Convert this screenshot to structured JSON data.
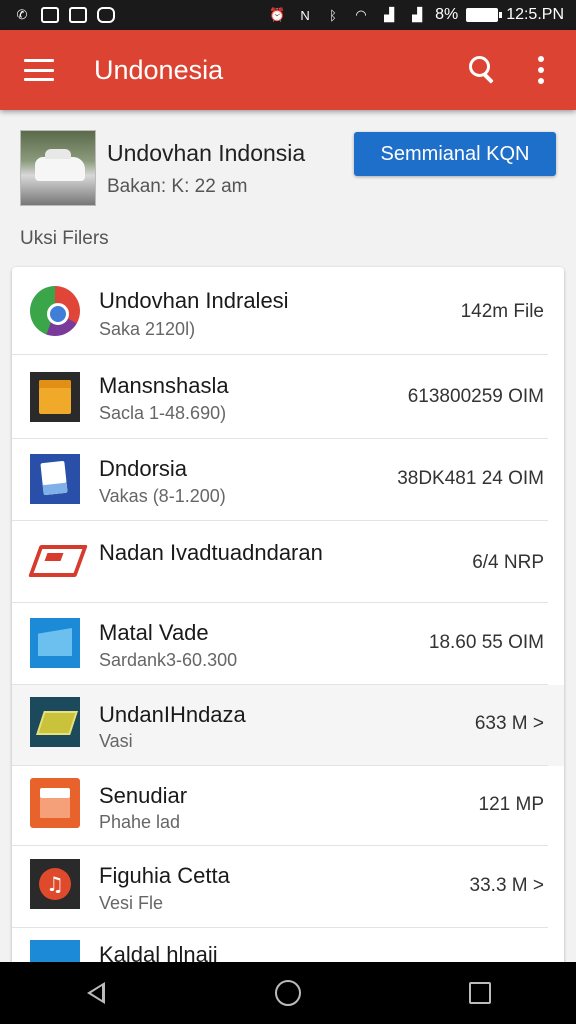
{
  "status_bar": {
    "left_icons": [
      "notification-icon",
      "photo-icon",
      "edit-icon",
      "message-icon"
    ],
    "battery": "8%",
    "time": "12:5.PN"
  },
  "app_bar": {
    "title": "Undonesia"
  },
  "header": {
    "title": "Undovhan Indonsia",
    "subtitle": "Bakan: K: 22 am",
    "button_label": "Semmianal KQN"
  },
  "section_label": "Uksi Filers",
  "files": [
    {
      "name": "Undovhan Indralesi",
      "sub": "Saka 2120l)",
      "size": "142m File",
      "icon": "chrome-icon"
    },
    {
      "name": "Mansnshasla",
      "sub": "Sacla 1-48.690)",
      "size": "613800259 OIM",
      "icon": "notes-icon"
    },
    {
      "name": "Dndorsia",
      "sub": "Vakas (8-1.200)",
      "size": "38DK481 24 OIM",
      "icon": "document-icon"
    },
    {
      "name": "Nadan Ivadtuadndaran",
      "sub": "",
      "size": "6/4 NRP",
      "icon": "shape-icon"
    },
    {
      "name": "Matal Vade",
      "sub": "Sardank3-60.300",
      "size": "18.60 55 OIM",
      "icon": "folder-icon"
    },
    {
      "name": "UndanIHndaza",
      "sub": "Vasi",
      "size": "633 M >",
      "icon": "chip-icon"
    },
    {
      "name": "Senudiar",
      "sub": "Phahe lad",
      "size": "121 MP",
      "icon": "slides-icon"
    },
    {
      "name": "Figuhia Cetta",
      "sub": "Vesi Fle",
      "size": "33.3 M >",
      "icon": "music-icon"
    },
    {
      "name": "Kaldal hlnaii",
      "sub": "",
      "size": "",
      "icon": "folder-icon"
    }
  ]
}
